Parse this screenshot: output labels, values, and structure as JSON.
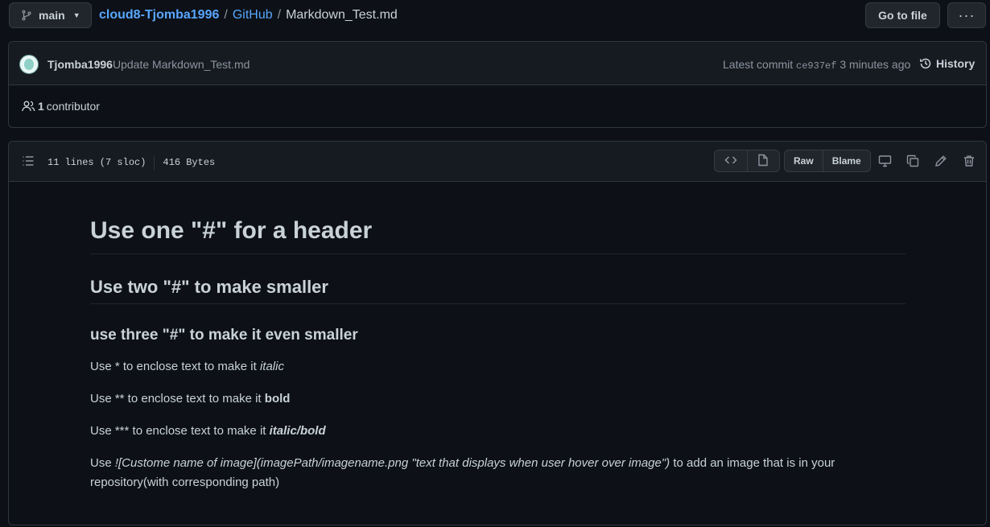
{
  "topbar": {
    "branch": "main",
    "breadcrumb": {
      "owner": "cloud8-Tjomba1996",
      "sep1": "/",
      "repo": "GitHub",
      "sep2": "/",
      "file": "Markdown_Test.md"
    },
    "goto_label": "Go to file",
    "more_label": "···"
  },
  "commit": {
    "author": "Tjomba1996",
    "message": "Update Markdown_Test.md",
    "latest_label": "Latest commit",
    "sha": "ce937ef",
    "time": "3 minutes ago",
    "history_label": "History"
  },
  "contributors": {
    "count": "1",
    "label": "contributor"
  },
  "file": {
    "lines": "11 lines (7 sloc)",
    "size": "416 Bytes",
    "raw_label": "Raw",
    "blame_label": "Blame"
  },
  "markdown": {
    "h1": "Use one \"#\" for a header",
    "h2": "Use two \"#\" to make smaller",
    "h3": "use three \"#\" to make it even smaller",
    "p1_text": "Use * to enclose text to make it ",
    "p1_em": "italic",
    "p2_text": "Use ** to enclose text to make it ",
    "p2_strong": "bold",
    "p3_text": "Use *** to enclose text to make it ",
    "p3_em_strong": "italic/bold",
    "p4_text": "Use ",
    "p4_em": "![Custome name of image](imagePath/imagename.png \"text that displays when user hover over image\")",
    "p4_tail": " to add an image that is in your repository(with corresponding path)"
  }
}
